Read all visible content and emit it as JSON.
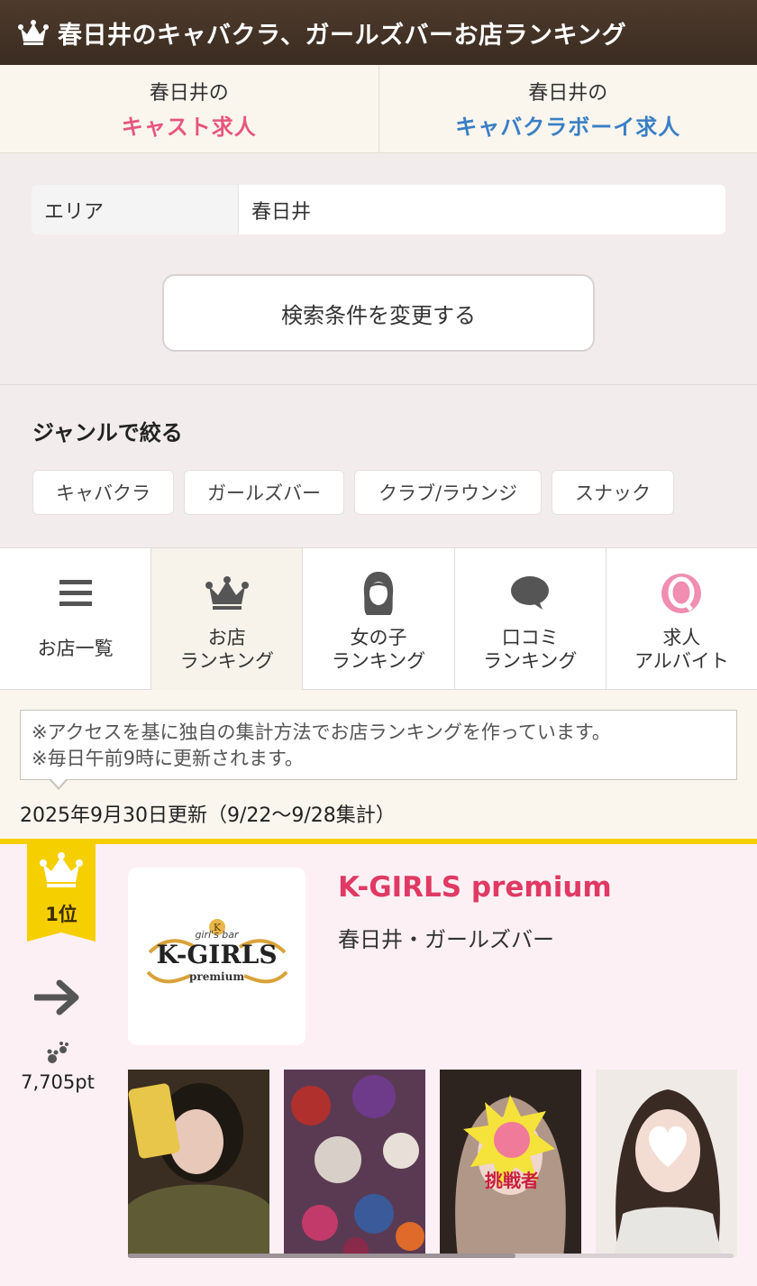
{
  "header": {
    "title": "春日井のキャバクラ、ガールズバーお店ランキング",
    "icon": "crown-icon"
  },
  "job_tabs": [
    {
      "line1": "春日井の",
      "line2": "キャスト求人",
      "color": "#e8567c"
    },
    {
      "line1": "春日井の",
      "line2": "キャバクラボーイ求人",
      "color": "#3a7fc4"
    }
  ],
  "search": {
    "area_label": "エリア",
    "area_value": "春日井",
    "change_button": "検索条件を変更する"
  },
  "genre": {
    "title": "ジャンルで絞る",
    "items": [
      "キャバクラ",
      "ガールズバー",
      "クラブ/ラウンジ",
      "スナック"
    ]
  },
  "nav_tabs": [
    {
      "label": "お店一覧",
      "icon": "list-icon",
      "active": false
    },
    {
      "label": "お店\nランキング",
      "icon": "crown-icon",
      "active": true
    },
    {
      "label": "女の子\nランキング",
      "icon": "girl-icon",
      "active": false
    },
    {
      "label": "口コミ\nランキング",
      "icon": "speech-bubble-icon",
      "active": false
    },
    {
      "label": "求人\nアルバイト",
      "icon": "q-icon",
      "active": false
    }
  ],
  "notice": {
    "line1": "※アクセスを基に独自の集計方法でお店ランキングを作っています。",
    "line2": "※毎日午前9時に更新されます。"
  },
  "updated": "2025年9月30日更新（9/22〜9/28集計）",
  "ranking": [
    {
      "rank_label": "1位",
      "trend": "right-arrow-icon",
      "points": "7,705pt",
      "logo_text": {
        "top": "girl's bar",
        "main": "K-GIRLS",
        "bottom": "premium"
      },
      "name": "K-GIRLS premium",
      "subtitle": "春日井・ガールズバー",
      "photo_badge": "挑戦者"
    }
  ],
  "colors": {
    "header_bg": "#3b2c21",
    "accent_pink": "#e03a64",
    "gold": "#f6cf00",
    "card_bg": "#fdf0f4"
  }
}
